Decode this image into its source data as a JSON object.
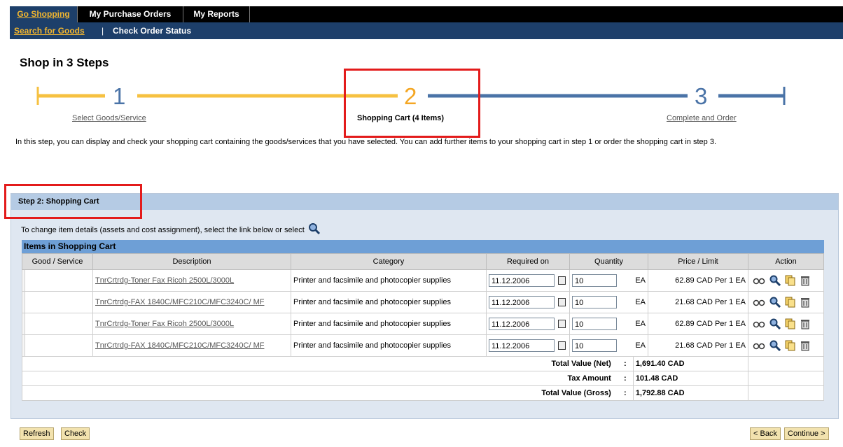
{
  "nav": {
    "tabs": [
      "Go Shopping",
      "My Purchase Orders",
      "My Reports"
    ],
    "sub_links": [
      "Search for Goods",
      "Check Order Status"
    ],
    "separator": "|"
  },
  "page_title": "Shop in 3 Steps",
  "steps": [
    {
      "number": "1",
      "label": "Select Goods/Service"
    },
    {
      "number": "2",
      "label": "Shopping Cart (4 Items)"
    },
    {
      "number": "3",
      "label": "Complete and Order"
    }
  ],
  "intro_text": "In this step, you can display and check your shopping cart containing the goods/services that you have selected. You can add further items to your shopping cart in step 1 or order the shopping cart in step 3.",
  "panel": {
    "title": "Step 2: Shopping Cart",
    "instruction": "To change item details (assets and cost assignment), select the link below or select"
  },
  "table": {
    "title": "Items in Shopping Cart",
    "headers": [
      "Good / Service",
      "Description",
      "Category",
      "Required on",
      "Quantity",
      "Price / Limit",
      "Action"
    ],
    "rows": [
      {
        "description": "TnrCrtrdg-Toner Fax Ricoh 2500L/3000L",
        "category": "Printer and facsimile and photocopier supplies",
        "date": "11.12.2006",
        "qty": "10",
        "unit": "EA",
        "price": "62.89 CAD Per 1 EA"
      },
      {
        "description": "TnrCrtrdg-FAX 1840C/MFC210C/MFC3240C/ MF",
        "category": "Printer and facsimile and photocopier supplies",
        "date": "11.12.2006",
        "qty": "10",
        "unit": "EA",
        "price": "21.68 CAD Per 1 EA"
      },
      {
        "description": "TnrCrtrdg-Toner Fax Ricoh 2500L/3000L",
        "category": "Printer and facsimile and photocopier supplies",
        "date": "11.12.2006",
        "qty": "10",
        "unit": "EA",
        "price": "62.89 CAD Per 1 EA"
      },
      {
        "description": "TnrCrtrdg-FAX 1840C/MFC210C/MFC3240C/ MF",
        "category": "Printer and facsimile and photocopier supplies",
        "date": "11.12.2006",
        "qty": "10",
        "unit": "EA",
        "price": "21.68 CAD Per 1 EA"
      }
    ],
    "totals": [
      {
        "label": "Total Value (Net)",
        "colon": ":",
        "value": "1,691.40 CAD"
      },
      {
        "label": "Tax Amount",
        "colon": ":",
        "value": "101.48 CAD"
      },
      {
        "label": "Total Value (Gross)",
        "colon": ":",
        "value": "1,792.88 CAD"
      }
    ]
  },
  "buttons": {
    "refresh": "Refresh",
    "check": "Check",
    "back": "< Back",
    "continue": "Continue >"
  },
  "colors": {
    "step_done": "#f6c141",
    "step_current": "#f4a623",
    "step_todo": "#4a73a7",
    "highlight": "#e31b1b"
  },
  "icons": [
    "search-icon",
    "calendar-icon",
    "glasses-icon",
    "magnifier-icon",
    "copy-icon",
    "trash-icon"
  ]
}
